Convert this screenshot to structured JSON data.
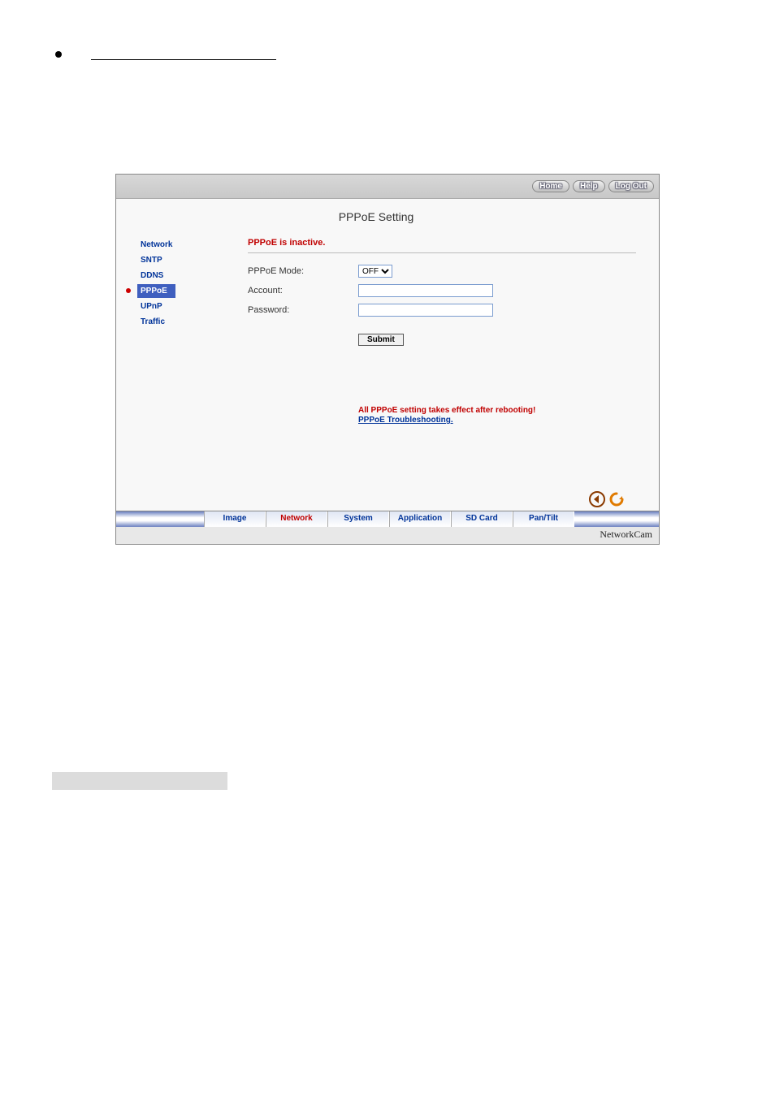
{
  "topbar": {
    "home": "Home",
    "help": "Help",
    "logout": "Log Out"
  },
  "title": "PPPoE Setting",
  "sidebar": {
    "network": "Network",
    "sntp": "SNTP",
    "ddns": "DDNS",
    "pppoe": "PPPoE",
    "upnp": "UPnP",
    "traffic": "Traffic"
  },
  "status": "PPPoE is inactive.",
  "form": {
    "mode_label": "PPPoE Mode:",
    "mode_value": "OFF",
    "account_label": "Account:",
    "account_value": "",
    "password_label": "Password:",
    "password_value": "",
    "submit": "Submit"
  },
  "warn": {
    "line": "All PPPoE setting takes effect after rebooting!",
    "link": "PPPoE Troubleshooting."
  },
  "tabs": {
    "image": "Image",
    "network": "Network",
    "system": "System",
    "application": "Application",
    "sdcard": "SD Card",
    "pantilt": "Pan/Tilt"
  },
  "brand": "NetworkCam"
}
